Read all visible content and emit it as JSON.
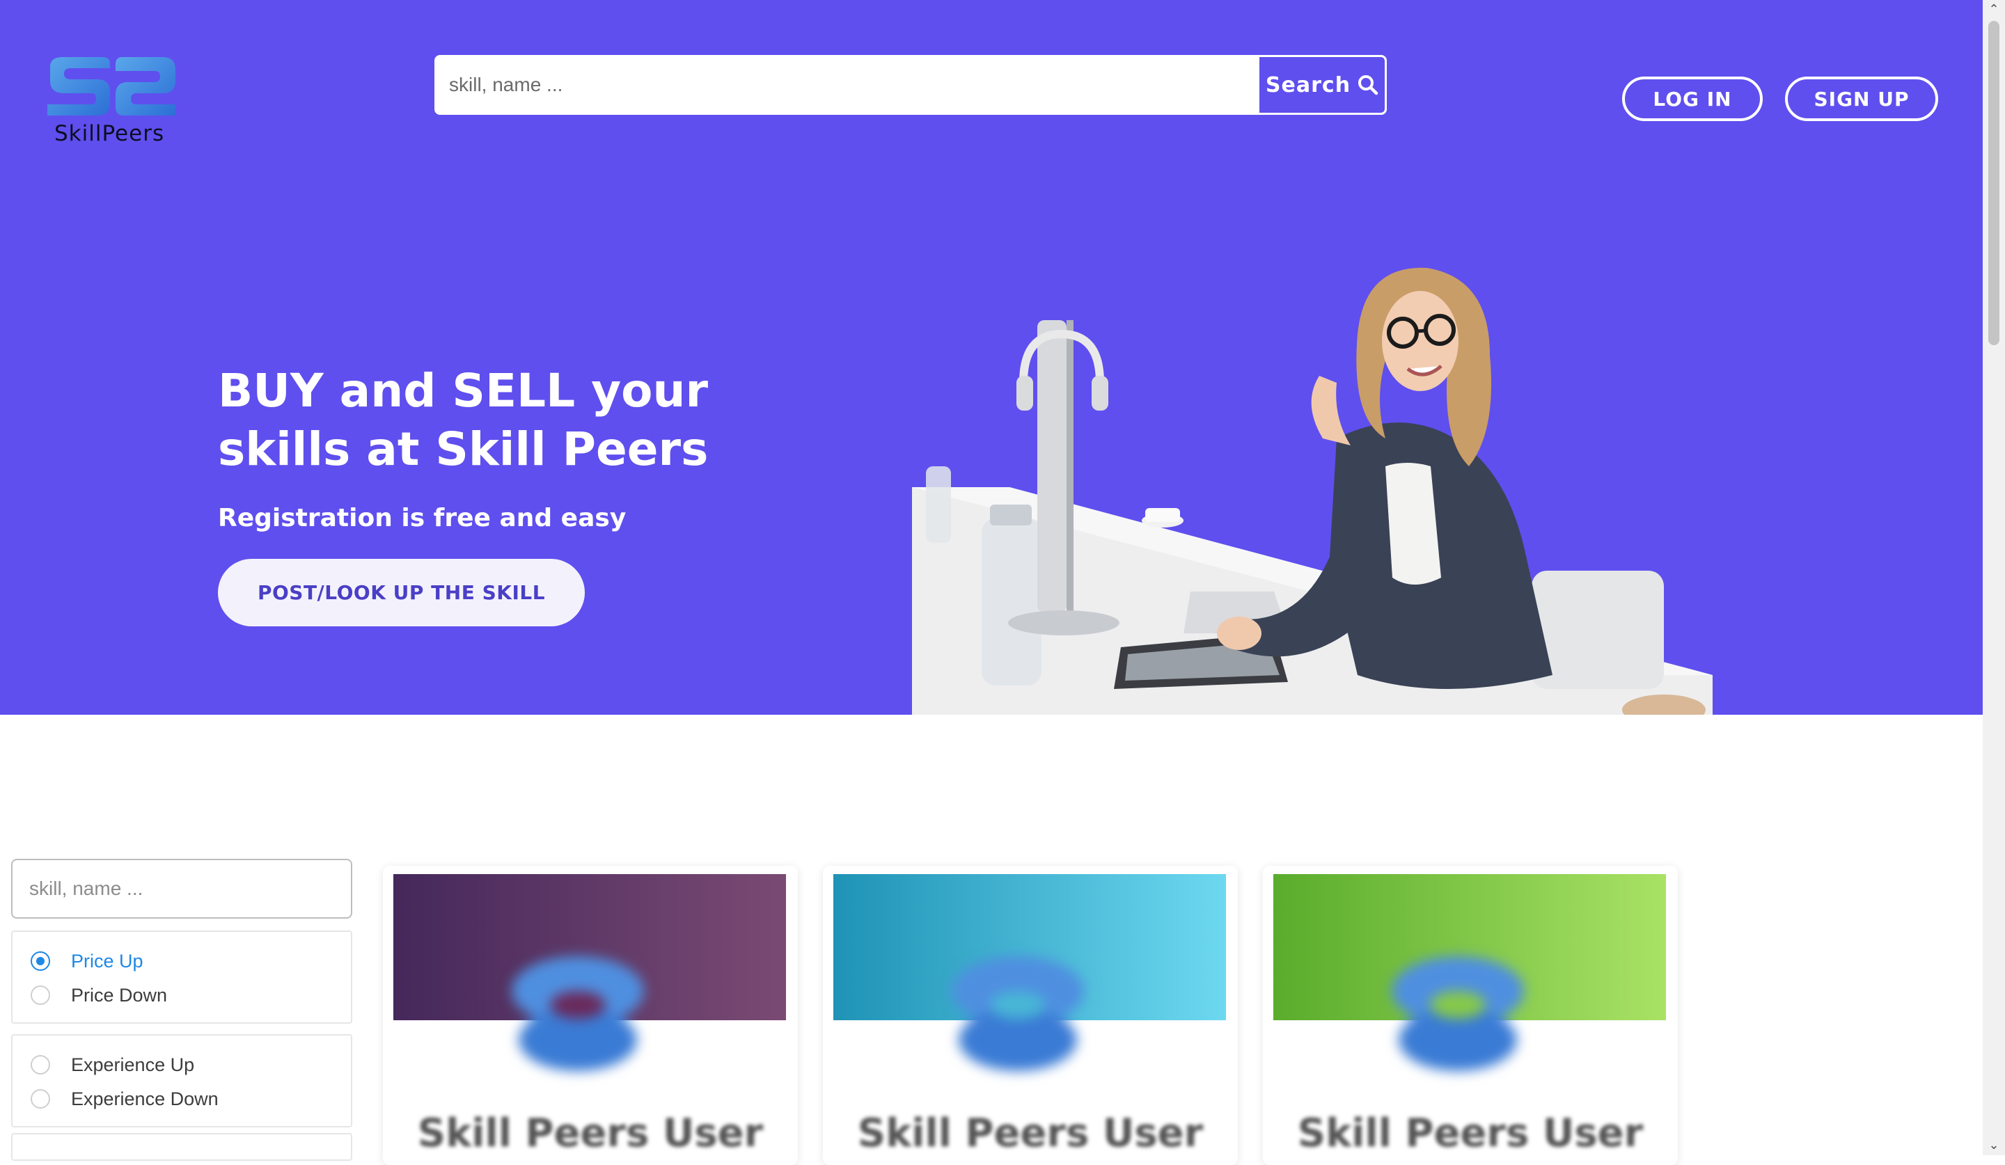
{
  "brand": {
    "logo_text": "SkillPeers",
    "hero_color": "#5f4fee"
  },
  "header": {
    "search_placeholder": "skill, name ...",
    "search_button_label": "Search",
    "login_label": "LOG IN",
    "signup_label": "SIGN UP"
  },
  "hero": {
    "title": "BUY and SELL your skills at Skill Peers",
    "subtitle": "Registration is free and easy",
    "cta_label": "POST/LOOK UP THE SKILL"
  },
  "filters": {
    "search_placeholder": "skill, name ...",
    "sort_price": [
      {
        "label": "Price Up",
        "selected": true
      },
      {
        "label": "Price Down",
        "selected": false
      }
    ],
    "sort_experience": [
      {
        "label": "Experience Up",
        "selected": false
      },
      {
        "label": "Experience Down",
        "selected": false
      }
    ]
  },
  "cards": [
    {
      "name": "Skill Peers User",
      "banner_colors": [
        "#45285b",
        "#7a4a73"
      ]
    },
    {
      "name": "Skill Peers User",
      "banner_colors": [
        "#1f93b6",
        "#6dd8f0"
      ]
    },
    {
      "name": "Skill Peers User",
      "banner_colors": [
        "#5aac2c",
        "#a9e265"
      ]
    }
  ],
  "icons": {
    "search": "magnifier-icon",
    "scroll_up": "chevron-up-icon",
    "scroll_down": "chevron-down-icon"
  }
}
